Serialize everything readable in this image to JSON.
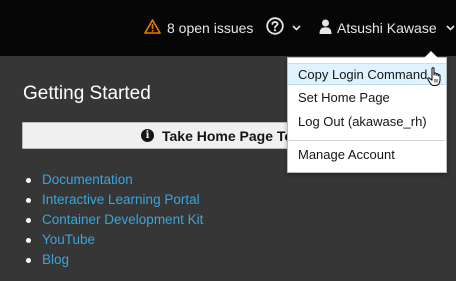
{
  "header": {
    "issues_label": "8 open issues",
    "user_name": "Atsushi Kawase",
    "icons": [
      "warning-triangle-icon",
      "help-circle-icon",
      "user-icon",
      "caret-down-icon"
    ],
    "warning_color": "#ec7a08"
  },
  "main": {
    "title": "Getting Started",
    "tour_button_label": "Take Home Page Tour",
    "links": [
      "Documentation",
      "Interactive Learning Portal",
      "Container Development Kit",
      "YouTube",
      "Blog"
    ],
    "link_color": "#39a5dc"
  },
  "dropdown": {
    "items": [
      "Copy Login Command",
      "Set Home Page",
      "Log Out (akawase_rh)",
      "Manage Account"
    ],
    "highlighted_item": "Copy Login Command",
    "highlight_color": "#def3ff"
  }
}
